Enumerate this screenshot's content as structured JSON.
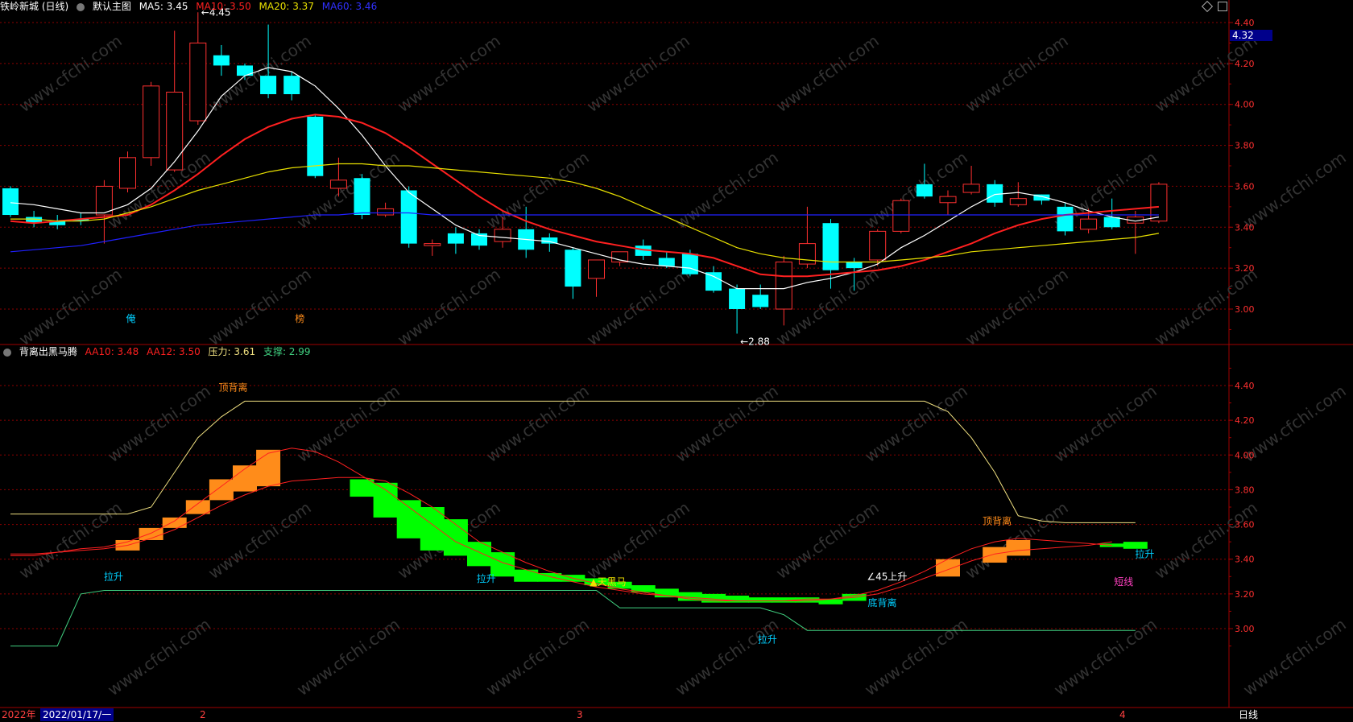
{
  "header": {
    "title": "铁岭新城 (日线)",
    "template": "默认主图",
    "indicators": [
      {
        "label": "MA5: 3.45",
        "color": "#ffffff"
      },
      {
        "label": "MA10: 3.50",
        "color": "#ff2020"
      },
      {
        "label": "MA20: 3.37",
        "color": "#e8e000"
      },
      {
        "label": "MA60: 3.46",
        "color": "#2020ff"
      }
    ]
  },
  "sub_header": {
    "title": "背离出黑马腾",
    "indicators": [
      {
        "label": "AA10: 3.48",
        "color": "#ff2020"
      },
      {
        "label": "AA12: 3.50",
        "color": "#ff2020"
      },
      {
        "label": "压力: 3.61",
        "color": "#f0e080"
      },
      {
        "label": "支撑: 2.99",
        "color": "#40d080"
      }
    ]
  },
  "price_box": "4.32",
  "footer": {
    "year": "2022年",
    "date": "2022/01/17/一",
    "months": [
      "2",
      "3",
      "4"
    ],
    "period": "日线"
  },
  "watermark": "www.cfchi.com",
  "colors": {
    "up": "#ff3030",
    "down": "#00ffff",
    "grid": "#8b0000",
    "orange": "#ff8c1a",
    "green": "#00ff00"
  },
  "chart_data": [
    {
      "type": "candlestick",
      "ylim": [
        2.8,
        4.48
      ],
      "yticks": [
        "4.40",
        "4.20",
        "4.00",
        "3.80",
        "3.60",
        "3.40",
        "3.20",
        "3.00"
      ],
      "candles": [
        {
          "o": 3.59,
          "h": 3.6,
          "c": 3.46,
          "l": 3.45
        },
        {
          "o": 3.45,
          "h": 3.48,
          "c": 3.42,
          "l": 3.4
        },
        {
          "o": 3.43,
          "h": 3.46,
          "c": 3.41,
          "l": 3.39
        },
        {
          "o": 3.44,
          "h": 3.47,
          "c": 3.43,
          "l": 3.41
        },
        {
          "o": 3.46,
          "h": 3.63,
          "c": 3.6,
          "l": 3.32
        },
        {
          "o": 3.59,
          "h": 3.77,
          "c": 3.74,
          "l": 3.57
        },
        {
          "o": 3.74,
          "h": 4.11,
          "c": 4.09,
          "l": 3.7
        },
        {
          "o": 3.68,
          "h": 4.36,
          "c": 4.06,
          "l": 3.67
        },
        {
          "o": 3.92,
          "h": 4.45,
          "c": 4.3,
          "l": 3.9
        },
        {
          "o": 4.24,
          "h": 4.29,
          "c": 4.19,
          "l": 4.14
        },
        {
          "o": 4.19,
          "h": 4.2,
          "c": 4.14,
          "l": 4.12
        },
        {
          "o": 4.14,
          "h": 4.39,
          "c": 4.05,
          "l": 4.03
        },
        {
          "o": 4.14,
          "h": 4.16,
          "c": 4.05,
          "l": 4.02
        },
        {
          "o": 3.94,
          "h": 3.95,
          "c": 3.65,
          "l": 3.64
        },
        {
          "o": 3.59,
          "h": 3.74,
          "c": 3.63,
          "l": 3.55
        },
        {
          "o": 3.64,
          "h": 3.66,
          "c": 3.46,
          "l": 3.44
        },
        {
          "o": 3.46,
          "h": 3.52,
          "c": 3.49,
          "l": 3.45
        },
        {
          "o": 3.58,
          "h": 3.6,
          "c": 3.32,
          "l": 3.3
        },
        {
          "o": 3.31,
          "h": 3.34,
          "c": 3.32,
          "l": 3.26
        },
        {
          "o": 3.37,
          "h": 3.4,
          "c": 3.32,
          "l": 3.27
        },
        {
          "o": 3.37,
          "h": 3.39,
          "c": 3.31,
          "l": 3.29
        },
        {
          "o": 3.33,
          "h": 3.45,
          "c": 3.39,
          "l": 3.3
        },
        {
          "o": 3.39,
          "h": 3.5,
          "c": 3.29,
          "l": 3.25
        },
        {
          "o": 3.35,
          "h": 3.37,
          "c": 3.32,
          "l": 3.28
        },
        {
          "o": 3.29,
          "h": 3.3,
          "c": 3.11,
          "l": 3.05
        },
        {
          "o": 3.15,
          "h": 3.22,
          "c": 3.24,
          "l": 3.06
        },
        {
          "o": 3.23,
          "h": 3.28,
          "c": 3.28,
          "l": 3.21
        },
        {
          "o": 3.31,
          "h": 3.34,
          "c": 3.26,
          "l": 3.24
        },
        {
          "o": 3.25,
          "h": 3.28,
          "c": 3.21,
          "l": 3.2
        },
        {
          "o": 3.27,
          "h": 3.29,
          "c": 3.17,
          "l": 3.16
        },
        {
          "o": 3.18,
          "h": 3.21,
          "c": 3.09,
          "l": 3.08
        },
        {
          "o": 3.1,
          "h": 3.12,
          "c": 3.0,
          "l": 2.88
        },
        {
          "o": 3.07,
          "h": 3.12,
          "c": 3.01,
          "l": 3.0
        },
        {
          "o": 3.0,
          "h": 3.26,
          "c": 3.23,
          "l": 2.92
        },
        {
          "o": 3.22,
          "h": 3.5,
          "c": 3.32,
          "l": 3.2
        },
        {
          "o": 3.42,
          "h": 3.44,
          "c": 3.19,
          "l": 3.1
        },
        {
          "o": 3.23,
          "h": 3.25,
          "c": 3.2,
          "l": 3.09
        },
        {
          "o": 3.24,
          "h": 3.39,
          "c": 3.38,
          "l": 3.21
        },
        {
          "o": 3.38,
          "h": 3.54,
          "c": 3.53,
          "l": 3.37
        },
        {
          "o": 3.61,
          "h": 3.71,
          "c": 3.55,
          "l": 3.54
        },
        {
          "o": 3.52,
          "h": 3.58,
          "c": 3.55,
          "l": 3.46
        },
        {
          "o": 3.57,
          "h": 3.7,
          "c": 3.61,
          "l": 3.56
        },
        {
          "o": 3.61,
          "h": 3.63,
          "c": 3.52,
          "l": 3.5
        },
        {
          "o": 3.51,
          "h": 3.62,
          "c": 3.54,
          "l": 3.5
        },
        {
          "o": 3.56,
          "h": 3.56,
          "c": 3.53,
          "l": 3.51
        },
        {
          "o": 3.5,
          "h": 3.52,
          "c": 3.38,
          "l": 3.36
        },
        {
          "o": 3.39,
          "h": 3.49,
          "c": 3.44,
          "l": 3.37
        },
        {
          "o": 3.45,
          "h": 3.54,
          "c": 3.4,
          "l": 3.39
        },
        {
          "o": 3.42,
          "h": 3.48,
          "c": 3.45,
          "l": 3.27
        },
        {
          "o": 3.43,
          "h": 3.62,
          "c": 3.61,
          "l": 3.42
        }
      ],
      "ma": [
        {
          "name": "MA5",
          "color": "#ffffff",
          "values": [
            3.52,
            3.51,
            3.49,
            3.47,
            3.47,
            3.51,
            3.59,
            3.72,
            3.87,
            4.04,
            4.14,
            4.18,
            4.16,
            4.09,
            3.98,
            3.85,
            3.7,
            3.57,
            3.49,
            3.41,
            3.36,
            3.35,
            3.34,
            3.33,
            3.3,
            3.27,
            3.24,
            3.22,
            3.21,
            3.2,
            3.16,
            3.1,
            3.1,
            3.1,
            3.13,
            3.15,
            3.18,
            3.22,
            3.3,
            3.36,
            3.43,
            3.5,
            3.56,
            3.57,
            3.55,
            3.52,
            3.48,
            3.45,
            3.43,
            3.45
          ]
        },
        {
          "name": "MA10",
          "color": "#ff2020",
          "values": [
            3.43,
            3.42,
            3.43,
            3.44,
            3.45,
            3.46,
            3.51,
            3.58,
            3.66,
            3.75,
            3.83,
            3.89,
            3.93,
            3.95,
            3.94,
            3.91,
            3.86,
            3.79,
            3.71,
            3.63,
            3.55,
            3.48,
            3.43,
            3.39,
            3.36,
            3.33,
            3.31,
            3.29,
            3.28,
            3.27,
            3.25,
            3.21,
            3.17,
            3.16,
            3.16,
            3.17,
            3.18,
            3.19,
            3.21,
            3.24,
            3.28,
            3.32,
            3.37,
            3.41,
            3.44,
            3.46,
            3.47,
            3.48,
            3.49,
            3.5
          ]
        },
        {
          "name": "MA20",
          "color": "#e8e000",
          "values": [
            3.44,
            3.44,
            3.43,
            3.43,
            3.44,
            3.47,
            3.5,
            3.54,
            3.58,
            3.61,
            3.64,
            3.67,
            3.69,
            3.7,
            3.71,
            3.71,
            3.7,
            3.7,
            3.69,
            3.68,
            3.67,
            3.66,
            3.65,
            3.64,
            3.62,
            3.59,
            3.55,
            3.5,
            3.45,
            3.4,
            3.35,
            3.3,
            3.27,
            3.25,
            3.24,
            3.23,
            3.23,
            3.23,
            3.24,
            3.25,
            3.26,
            3.28,
            3.29,
            3.3,
            3.31,
            3.32,
            3.33,
            3.34,
            3.35,
            3.37
          ]
        },
        {
          "name": "MA60",
          "color": "#2020ff",
          "values": [
            3.28,
            3.29,
            3.3,
            3.31,
            3.33,
            3.35,
            3.37,
            3.39,
            3.41,
            3.42,
            3.43,
            3.44,
            3.45,
            3.46,
            3.46,
            3.47,
            3.47,
            3.47,
            3.46,
            3.46,
            3.46,
            3.46,
            3.46,
            3.46,
            3.46,
            3.46,
            3.46,
            3.46,
            3.46,
            3.46,
            3.46,
            3.46,
            3.46,
            3.46,
            3.46,
            3.46,
            3.46,
            3.46,
            3.46,
            3.46,
            3.46,
            3.46,
            3.46,
            3.46,
            3.46,
            3.46,
            3.46,
            3.46,
            3.46,
            3.46
          ]
        }
      ],
      "annotations": [
        {
          "text": "4.45",
          "index": 8,
          "value": 4.45,
          "color": "#ffffff"
        },
        {
          "text": "2.88",
          "index": 31,
          "value": 2.88,
          "color": "#ffffff"
        }
      ]
    },
    {
      "type": "indicator",
      "ylim": [
        2.88,
        4.52
      ],
      "yticks": [
        "4.40",
        "4.20",
        "4.00",
        "3.80",
        "3.60",
        "3.40",
        "3.20",
        "3.00"
      ],
      "pressure": [
        3.66,
        3.66,
        3.66,
        3.66,
        3.66,
        3.66,
        3.7,
        3.9,
        4.1,
        4.22,
        4.31,
        4.31,
        4.31,
        4.31,
        4.31,
        4.31,
        4.31,
        4.31,
        4.31,
        4.31,
        4.31,
        4.31,
        4.31,
        4.31,
        4.31,
        4.31,
        4.31,
        4.31,
        4.31,
        4.31,
        4.31,
        4.31,
        4.31,
        4.31,
        4.31,
        4.31,
        4.31,
        4.31,
        4.31,
        4.31,
        4.25,
        4.1,
        3.9,
        3.65,
        3.62,
        3.61,
        3.61,
        3.61,
        3.61
      ],
      "support": [
        2.9,
        2.9,
        2.9,
        3.2,
        3.22,
        3.22,
        3.22,
        3.22,
        3.22,
        3.22,
        3.22,
        3.22,
        3.22,
        3.22,
        3.22,
        3.22,
        3.22,
        3.22,
        3.22,
        3.22,
        3.22,
        3.22,
        3.22,
        3.22,
        3.22,
        3.22,
        3.12,
        3.12,
        3.12,
        3.12,
        3.12,
        3.12,
        3.12,
        3.08,
        2.99,
        2.99,
        2.99,
        2.99,
        2.99,
        2.99,
        2.99,
        2.99,
        2.99,
        2.99,
        2.99,
        2.99,
        2.99,
        2.99,
        2.99
      ],
      "aa10": [
        3.42,
        3.42,
        3.44,
        3.46,
        3.47,
        3.5,
        3.55,
        3.62,
        3.72,
        3.82,
        3.92,
        4.01,
        4.04,
        4.02,
        3.96,
        3.88,
        3.8,
        3.7,
        3.6,
        3.5,
        3.44,
        3.38,
        3.34,
        3.3,
        3.27,
        3.24,
        3.22,
        3.2,
        3.19,
        3.17,
        3.16,
        3.16,
        3.16,
        3.16,
        3.16,
        3.17,
        3.19,
        3.22,
        3.27,
        3.33,
        3.4,
        3.46,
        3.5,
        3.52,
        3.51,
        3.5,
        3.49,
        3.48
      ],
      "aa12": [
        3.43,
        3.43,
        3.44,
        3.45,
        3.46,
        3.48,
        3.52,
        3.57,
        3.64,
        3.71,
        3.77,
        3.82,
        3.85,
        3.86,
        3.87,
        3.87,
        3.85,
        3.78,
        3.7,
        3.6,
        3.5,
        3.44,
        3.38,
        3.33,
        3.29,
        3.26,
        3.23,
        3.21,
        3.19,
        3.18,
        3.17,
        3.16,
        3.16,
        3.16,
        3.17,
        3.17,
        3.18,
        3.2,
        3.24,
        3.29,
        3.34,
        3.39,
        3.43,
        3.45,
        3.46,
        3.47,
        3.48,
        3.5
      ],
      "bars": [
        {
          "index": 5,
          "top": 3.51,
          "bottom": 3.45,
          "color": "orange"
        },
        {
          "index": 6,
          "top": 3.58,
          "bottom": 3.51,
          "color": "orange"
        },
        {
          "index": 7,
          "top": 3.64,
          "bottom": 3.58,
          "color": "orange"
        },
        {
          "index": 8,
          "top": 3.74,
          "bottom": 3.66,
          "color": "orange"
        },
        {
          "index": 9,
          "top": 3.86,
          "bottom": 3.74,
          "color": "orange"
        },
        {
          "index": 10,
          "top": 3.94,
          "bottom": 3.79,
          "color": "orange"
        },
        {
          "index": 11,
          "top": 4.03,
          "bottom": 3.82,
          "color": "orange"
        },
        {
          "index": 15,
          "top": 3.86,
          "bottom": 3.76,
          "color": "green"
        },
        {
          "index": 16,
          "top": 3.84,
          "bottom": 3.64,
          "color": "green"
        },
        {
          "index": 17,
          "top": 3.74,
          "bottom": 3.52,
          "color": "green"
        },
        {
          "index": 18,
          "top": 3.7,
          "bottom": 3.45,
          "color": "green"
        },
        {
          "index": 19,
          "top": 3.63,
          "bottom": 3.42,
          "color": "green"
        },
        {
          "index": 20,
          "top": 3.5,
          "bottom": 3.36,
          "color": "green"
        },
        {
          "index": 21,
          "top": 3.44,
          "bottom": 3.3,
          "color": "green"
        },
        {
          "index": 22,
          "top": 3.34,
          "bottom": 3.27,
          "color": "green"
        },
        {
          "index": 23,
          "top": 3.32,
          "bottom": 3.27,
          "color": "green"
        },
        {
          "index": 24,
          "top": 3.31,
          "bottom": 3.27,
          "color": "green"
        },
        {
          "index": 25,
          "top": 3.29,
          "bottom": 3.25,
          "color": "green"
        },
        {
          "index": 26,
          "top": 3.27,
          "bottom": 3.23,
          "color": "green"
        },
        {
          "index": 27,
          "top": 3.25,
          "bottom": 3.21,
          "color": "green"
        },
        {
          "index": 28,
          "top": 3.23,
          "bottom": 3.18,
          "color": "green"
        },
        {
          "index": 29,
          "top": 3.21,
          "bottom": 3.16,
          "color": "green"
        },
        {
          "index": 30,
          "top": 3.2,
          "bottom": 3.15,
          "color": "green"
        },
        {
          "index": 31,
          "top": 3.19,
          "bottom": 3.15,
          "color": "green"
        },
        {
          "index": 32,
          "top": 3.18,
          "bottom": 3.15,
          "color": "green"
        },
        {
          "index": 33,
          "top": 3.18,
          "bottom": 3.15,
          "color": "green"
        },
        {
          "index": 34,
          "top": 3.18,
          "bottom": 3.15,
          "color": "green"
        },
        {
          "index": 35,
          "top": 3.17,
          "bottom": 3.14,
          "color": "green"
        },
        {
          "index": 36,
          "top": 3.2,
          "bottom": 3.16,
          "color": "green"
        },
        {
          "index": 40,
          "top": 3.4,
          "bottom": 3.3,
          "color": "orange"
        },
        {
          "index": 42,
          "top": 3.47,
          "bottom": 3.38,
          "color": "orange"
        },
        {
          "index": 43,
          "top": 3.51,
          "bottom": 3.42,
          "color": "orange"
        },
        {
          "index": 47,
          "top": 3.49,
          "bottom": 3.47,
          "color": "green"
        },
        {
          "index": 48,
          "top": 3.5,
          "bottom": 3.46,
          "color": "green"
        }
      ],
      "labels": [
        {
          "text": "顶背离",
          "index": 9.5,
          "value": 4.37,
          "color": "#ff8c1a"
        },
        {
          "text": "拉升",
          "index": 4.4,
          "value": 3.28,
          "color": "#00cfff"
        },
        {
          "text": "拉升",
          "index": 20.3,
          "value": 3.27,
          "color": "#00cfff"
        },
        {
          "text": "▲天黑马",
          "index": 25.5,
          "value": 3.25,
          "color": "#f0e000"
        },
        {
          "text": "∠45上升",
          "index": 37.4,
          "value": 3.28,
          "color": "#ffffff"
        },
        {
          "text": "底背离",
          "index": 37.2,
          "value": 3.13,
          "color": "#00cfff"
        },
        {
          "text": "拉升",
          "index": 32.3,
          "value": 2.92,
          "color": "#00cfff"
        },
        {
          "text": "顶背离",
          "index": 42.1,
          "value": 3.6,
          "color": "#ff8c1a"
        },
        {
          "text": "拉升",
          "index": 48.4,
          "value": 3.41,
          "color": "#00cfff"
        },
        {
          "text": "短线",
          "index": 47.5,
          "value": 3.25,
          "color": "#ff40c0"
        }
      ]
    }
  ]
}
